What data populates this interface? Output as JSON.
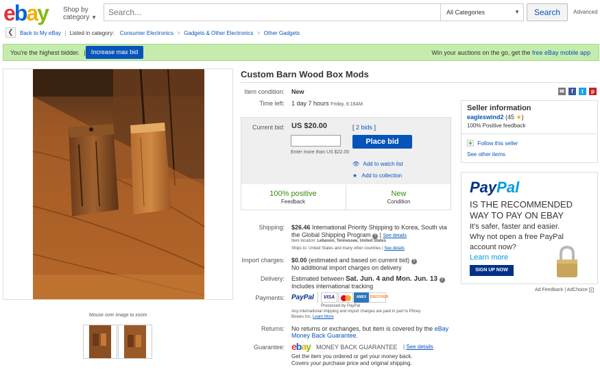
{
  "header": {
    "logo_letters": [
      {
        "char": "e",
        "color": "#e53238"
      },
      {
        "char": "b",
        "color": "#0064d2"
      },
      {
        "char": "a",
        "color": "#f5af02"
      },
      {
        "char": "y",
        "color": "#86b817"
      }
    ],
    "shop_by_line1": "Shop by",
    "shop_by_line2": "category",
    "search_placeholder": "Search...",
    "category_value": "All Categories",
    "search_button": "Search",
    "advanced_link": "Advanced"
  },
  "breadcrumb": {
    "back_label": "Back to My eBay",
    "listed_in": "Listed in category:",
    "items": [
      "Consumer Electronics",
      "Gadgets & Other Electronics",
      "Other Gadgets"
    ]
  },
  "status_bar": {
    "message": "You're the highest bidder.",
    "increase_button": "Increase max bid",
    "promo_text": "Win your auctions on the go, get the",
    "promo_link": "free eBay mobile app"
  },
  "gallery": {
    "zoom_hint": "Mouse over image to zoom"
  },
  "item": {
    "title": "Custom Barn Wood Box Mods",
    "condition_label": "Item condition:",
    "condition_value": "New",
    "time_left_label": "Time left:",
    "time_left_value": "1 day 7 hours",
    "time_left_end": "Friday, 6:16AM"
  },
  "bid": {
    "current_bid_label": "Current bid:",
    "current_bid_value": "US $20.00",
    "bids_count": "2 bids",
    "place_bid_button": "Place bid",
    "enter_more": "Enter more than US $22.00",
    "watch_list": "Add to watch list",
    "add_collection": "Add to collection",
    "feedback_value": "100% positive",
    "feedback_label": "Feedback",
    "condition_value": "New",
    "condition_label": "Condition"
  },
  "shipping": {
    "label": "Shipping:",
    "amount": "$26.46",
    "desc_line1": "International Priority Shipping to Korea, South  via",
    "desc_line2": "the Global Shipping Program",
    "see_details": "See details",
    "item_location_label": "Item location:",
    "item_location": "Lebanon, Tennessee, United States",
    "ships_to_label": "Ships to:",
    "ships_to": "United States and many other countries",
    "ships_details": "See details"
  },
  "import": {
    "label": "Import charges:",
    "amount": "$0.00",
    "desc": "(estimated and based on current bid)",
    "line2": "No additional import charges on delivery"
  },
  "delivery": {
    "label": "Delivery:",
    "prefix": "Estimated between",
    "range": "Sat. Jun. 4 and Mon. Jun. 13",
    "line2": "Includes international tracking"
  },
  "payments": {
    "label": "Payments:",
    "paypal": "PayPal",
    "processed_by": "Processed by PayPal",
    "note_line1": "Any international shipping and import charges are paid in part to Pitney",
    "note_line2": "Bowes Inc.",
    "learn_more": "Learn More",
    "cards": [
      {
        "name": "VISA",
        "bg": "#ffffff",
        "fg": "#1a1f71"
      },
      {
        "name": "MC",
        "bg": "#ffffff",
        "fg": "#eb001b"
      },
      {
        "name": "AMEX",
        "bg": "#2e77bb",
        "fg": "#ffffff"
      },
      {
        "name": "DISCOVER",
        "bg": "#ffffff",
        "fg": "#f58220"
      }
    ]
  },
  "returns": {
    "label": "Returns:",
    "line1": "No returns or exchanges, but item is covered by the",
    "link1": "eBay",
    "link2": "Money Back Guarantee."
  },
  "guarantee": {
    "label": "Guarantee:",
    "badge_text": "MONEY BACK GUARANTEE",
    "see_details": "See details",
    "line1": "Get the item you ordered or get your money back.",
    "line2": "Covers your purchase price and original shipping."
  },
  "seller": {
    "heading": "Seller information",
    "username": "eagleswind2",
    "score": "(45",
    "score_close": ")",
    "positive": "100% Positive feedback",
    "follow": "Follow this seller",
    "other_items": "See other items"
  },
  "ad": {
    "paypal_logo_pay": "Pay",
    "paypal_logo_pal": "Pal",
    "headline1": "IS THE RECOMMENDED",
    "headline2": "WAY TO PAY ON EBAY",
    "body1": "It's safer, faster and easier.",
    "body2": "Why not open a free PayPal",
    "body3": "account now?",
    "learn_more": "Learn more",
    "signup": "SIGN UP NOW",
    "feedback": "Ad Feedback",
    "adchoice": "AdChoice"
  },
  "colors": {
    "link": "#0654ba",
    "green_bar": "#c5ecad",
    "primary_button": "#0654ba",
    "positive_green": "#3a8c0c"
  }
}
